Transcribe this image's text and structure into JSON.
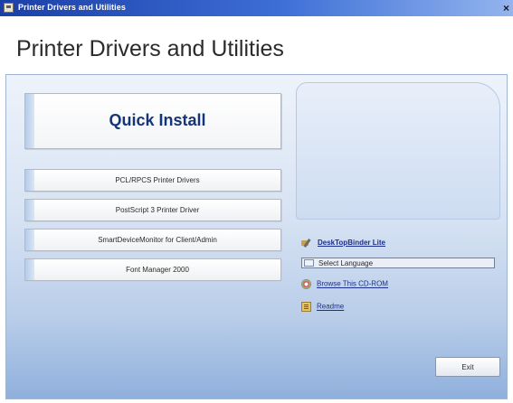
{
  "window": {
    "title": "Printer Drivers and Utilities",
    "close_glyph": "×"
  },
  "header": {
    "heading": "Printer Drivers and Utilities"
  },
  "main": {
    "quick_install_label": "Quick Install",
    "buttons": [
      {
        "label": "PCL/RPCS Printer Drivers"
      },
      {
        "label": "PostScript 3 Printer Driver"
      },
      {
        "label": "SmartDeviceMonitor for Client/Admin"
      },
      {
        "label": "Font Manager 2000"
      }
    ]
  },
  "links": {
    "desktopbinder": "DeskTopBinder Lite",
    "select_language": "Select Language",
    "browse_cd": "Browse This CD-ROM",
    "readme": "Readme"
  },
  "footer": {
    "exit_label": "Exit"
  },
  "icons": [
    "app-icon",
    "close-icon",
    "desktopbinder-icon",
    "language-icon",
    "cd-icon",
    "readme-icon"
  ]
}
